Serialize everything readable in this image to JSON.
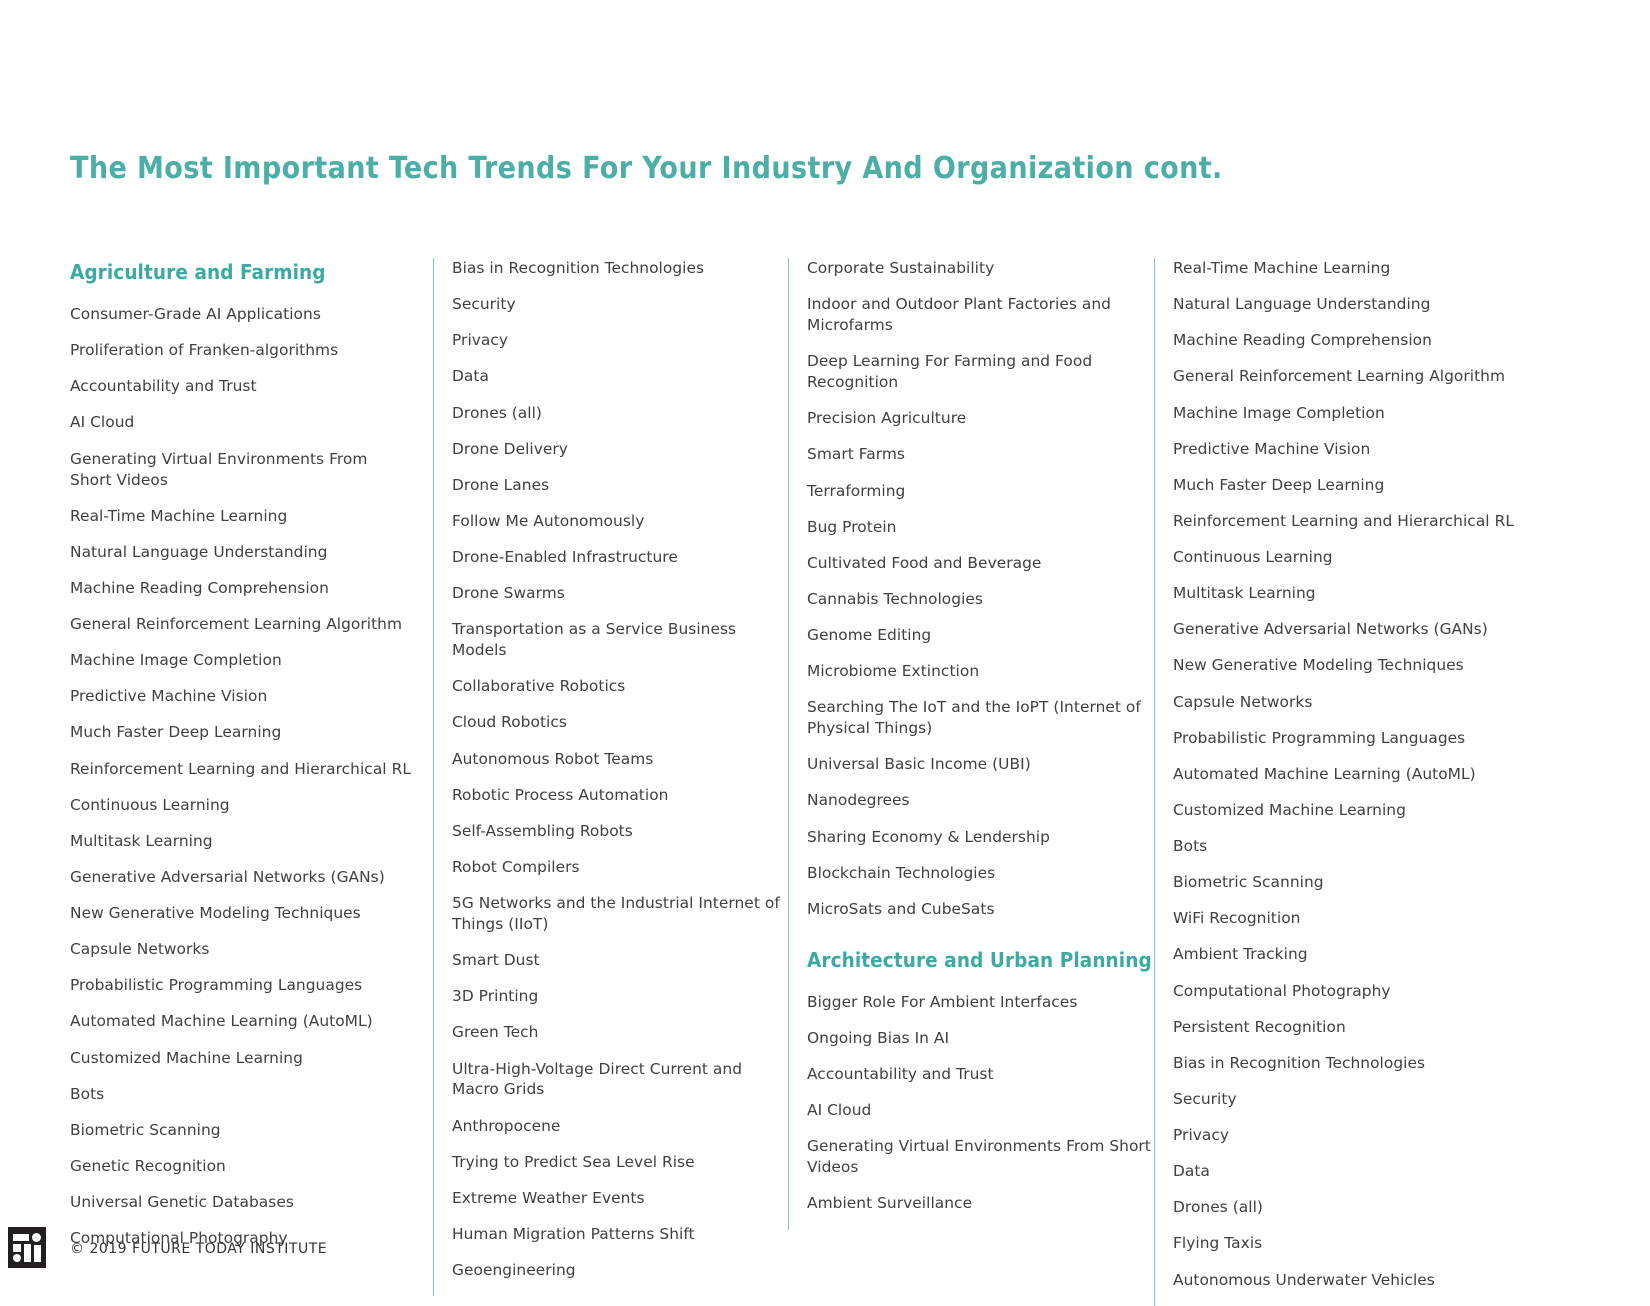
{
  "header": {
    "title": "The Most Important Tech Trends For Your Industry And Organization cont."
  },
  "theme": {
    "accent": "#4BAEA7",
    "heading_color": "#3AAAA2",
    "divider_color": "#7DC6C0",
    "text_color": "#404040",
    "background": "#ffffff",
    "logo_color": "#231F20"
  },
  "columns": [
    {
      "id": "column-1",
      "sections": [
        {
          "heading": "Agriculture and Farming",
          "items": [
            "Consumer-Grade AI Applications",
            "Proliferation of Franken-algorithms",
            "Accountability and Trust",
            "AI Cloud",
            "Generating Virtual Environments From Short Videos",
            "Real-Time Machine Learning",
            "Natural Language Understanding",
            "Machine Reading Comprehension",
            "General Reinforcement Learning Algorithm",
            "Machine Image Completion",
            "Predictive Machine Vision",
            "Much Faster Deep Learning",
            "Reinforcement Learning and Hierarchical RL",
            "Continuous Learning",
            "Multitask Learning",
            "Generative Adversarial Networks (GANs)",
            "New Generative Modeling Techniques",
            "Capsule Networks",
            "Probabilistic Programming Languages",
            "Automated Machine Learning (AutoML)",
            "Customized Machine Learning",
            "Bots",
            "Biometric Scanning",
            "Genetic Recognition",
            "Universal Genetic Databases",
            "Computational Photography"
          ]
        }
      ]
    },
    {
      "id": "column-2",
      "sections": [
        {
          "heading": "",
          "items": [
            "Bias in Recognition Technologies",
            "Security",
            "Privacy",
            "Data",
            "Drones (all)",
            "Drone Delivery",
            "Drone Lanes",
            "Follow Me Autonomously",
            "Drone-Enabled Infrastructure",
            "Drone Swarms",
            "Transportation as a Service Business Models",
            "Collaborative Robotics",
            "Cloud Robotics",
            "Autonomous Robot Teams",
            "Robotic Process Automation",
            "Self-Assembling Robots",
            "Robot Compilers",
            "5G Networks and the Industrial Internet of Things (IIoT)",
            "Smart Dust",
            "3D Printing",
            "Green Tech",
            "Ultra-High-Voltage Direct Current and Macro Grids",
            "Anthropocene",
            "Trying to Predict Sea Level Rise",
            "Extreme Weather Events",
            "Human Migration Patterns Shift",
            "Geoengineering"
          ]
        }
      ]
    },
    {
      "id": "column-3",
      "sections": [
        {
          "heading": "",
          "items": [
            "Corporate Sustainability",
            "Indoor and Outdoor Plant Factories and Microfarms",
            "Deep Learning For Farming and Food Recognition",
            "Precision Agriculture",
            "Smart Farms",
            "Terraforming",
            "Bug Protein",
            "Cultivated Food and Beverage",
            "Cannabis Technologies",
            "Genome Editing",
            "Microbiome Extinction",
            "Searching The IoT and the IoPT (Internet of Physical Things)",
            "Universal Basic Income (UBI)",
            "Nanodegrees",
            "Sharing Economy & Lendership",
            "Blockchain Technologies",
            "MicroSats and CubeSats"
          ]
        },
        {
          "heading": "Architecture and Urban Planning",
          "items": [
            "Bigger Role For Ambient Interfaces",
            "Ongoing Bias In AI",
            "Accountability and Trust",
            "AI Cloud",
            "Generating Virtual Environments From Short Videos",
            "Ambient Surveillance"
          ]
        }
      ]
    },
    {
      "id": "column-4",
      "sections": [
        {
          "heading": "",
          "items": [
            "Real-Time Machine Learning",
            "Natural Language Understanding",
            "Machine Reading Comprehension",
            "General Reinforcement Learning Algorithm",
            "Machine Image Completion",
            "Predictive Machine Vision",
            "Much Faster Deep Learning",
            "Reinforcement Learning and Hierarchical RL",
            "Continuous Learning",
            "Multitask Learning",
            "Generative Adversarial Networks (GANs)",
            "New Generative Modeling Techniques",
            "Capsule Networks",
            "Probabilistic Programming Languages",
            "Automated Machine Learning (AutoML)",
            "Customized Machine Learning",
            "Bots",
            "Biometric Scanning",
            "WiFi Recognition",
            "Ambient Tracking",
            "Computational Photography",
            "Persistent Recognition",
            "Bias in Recognition Technologies",
            "Security",
            "Privacy",
            "Data",
            "Drones (all)",
            "Flying Taxis",
            "Autonomous Underwater Vehicles"
          ]
        }
      ]
    }
  ],
  "footer": {
    "logo_name": "future-today-institute-logo",
    "copyright": "© 2019 FUTURE TODAY INSTITUTE"
  }
}
